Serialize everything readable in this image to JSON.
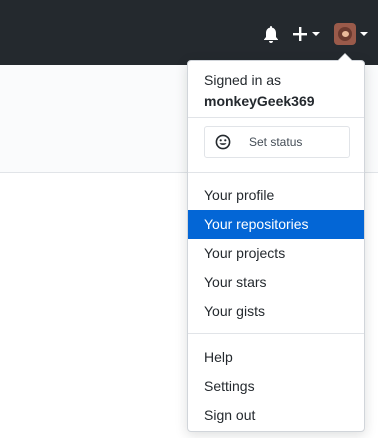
{
  "header": {
    "icons": {
      "notifications": "bell-icon",
      "create": "plus-icon",
      "create_caret": "chevron-down-icon",
      "profile_caret": "chevron-down-icon"
    },
    "bg_color": "#24292e"
  },
  "dropdown": {
    "signed_in_label": "Signed in as",
    "username": "monkeyGeek369",
    "set_status_label": "Set status",
    "profile_items": [
      {
        "label": "Your profile"
      },
      {
        "label": "Your repositories"
      },
      {
        "label": "Your projects"
      },
      {
        "label": "Your stars"
      },
      {
        "label": "Your gists"
      }
    ],
    "account_items": [
      {
        "label": "Help"
      },
      {
        "label": "Settings"
      },
      {
        "label": "Sign out"
      }
    ],
    "highlight_color": "#0366d6"
  }
}
